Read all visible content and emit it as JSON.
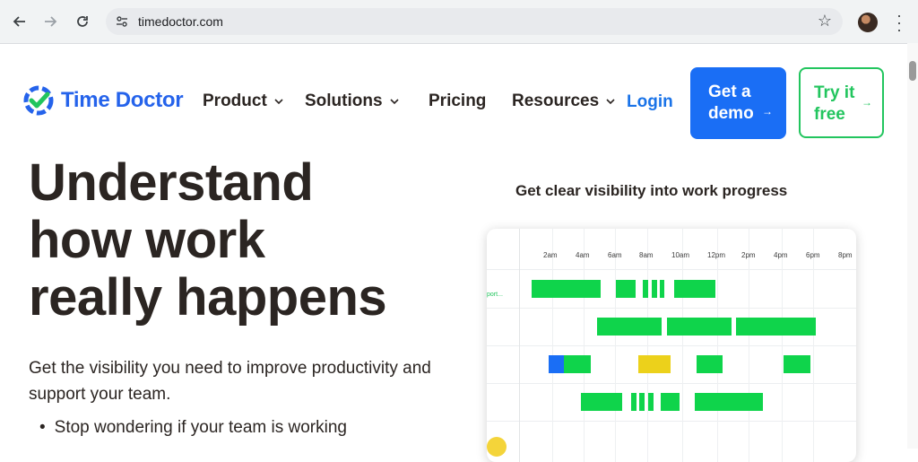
{
  "browser": {
    "url": "timedoctor.com",
    "icons": [
      "back-icon",
      "forward-icon",
      "reload-icon",
      "site-settings-icon",
      "bookmark-star-icon",
      "more-menu-icon"
    ]
  },
  "header": {
    "logo_text": "Time Doctor",
    "nav": [
      {
        "label": "Product",
        "has_dropdown": true
      },
      {
        "label": "Solutions",
        "has_dropdown": true
      },
      {
        "label": "Pricing",
        "has_dropdown": false
      },
      {
        "label": "Resources",
        "has_dropdown": true
      }
    ],
    "login_label": "Login",
    "demo_label_1": "Get a",
    "demo_label_2": "demo",
    "try_label_1": "Try it",
    "try_label_2": "free",
    "arrow": "→"
  },
  "hero": {
    "title_line1": "Understand",
    "title_line2": "how work",
    "title_line3": "really happens",
    "subtitle": "Get the visibility you need to improve productivity and support your team.",
    "bullet_1": "Stop wondering if your team is working"
  },
  "visual": {
    "title": "Get clear visibility into work progress",
    "row_label": "port...",
    "ticks": [
      "2am",
      "4am",
      "6am",
      "8am",
      "10am",
      "12pm",
      "2pm",
      "4pm",
      "6pm",
      "8pm"
    ]
  },
  "colors": {
    "brand_blue": "#2563eb",
    "demo_blue": "#1a6ef5",
    "green": "#22c55e",
    "bar_green": "#0fd44b",
    "bar_yellow": "#ecd11b",
    "text_dark": "#2b2522"
  }
}
